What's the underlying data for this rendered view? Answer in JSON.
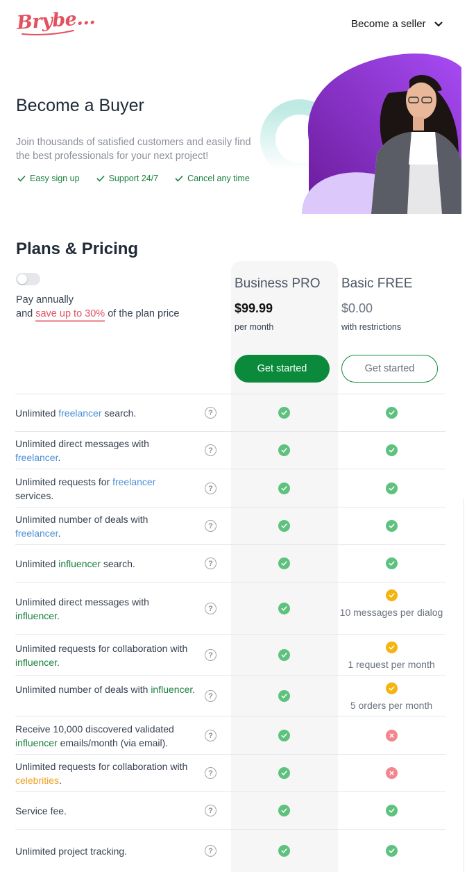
{
  "brand": {
    "logo_text": "Brybe...",
    "accent": "#e2515f"
  },
  "header": {
    "seller_label": "Become a seller",
    "seller_icon": "chevron-down-icon"
  },
  "hero": {
    "title": "Become a Buyer",
    "subtitle": "Join thousands of satisfied customers and easily find the best professionals for your next project!",
    "checks": [
      "Easy sign up",
      "Support 24/7",
      "Cancel any time"
    ]
  },
  "pricing": {
    "title": "Plans & Pricing",
    "toggle_on": false,
    "pay_annually": "Pay annually",
    "save_prefix": "and",
    "save_link": "save up to 30%",
    "save_suffix": "of the plan price",
    "plans": [
      {
        "name": "Business PRO",
        "price": "$99.99",
        "note": "per month",
        "button": "Get started"
      },
      {
        "name": "Basic FREE",
        "price": "$0.00",
        "note": "with restrictions",
        "button": "Get started"
      }
    ],
    "features": [
      {
        "pre": "Unlimited ",
        "hl": "freelancer",
        "hl_color": "blue",
        "post": " search.",
        "pro": "check",
        "free": "check",
        "free_note": ""
      },
      {
        "pre": "Unlimited direct messages with ",
        "hl": "freelancer",
        "hl_color": "blue",
        "post": ".",
        "pro": "check",
        "free": "check",
        "free_note": ""
      },
      {
        "pre": "Unlimited requests for ",
        "hl": "freelancer",
        "hl_color": "blue",
        "post": " services.",
        "pro": "check",
        "free": "check",
        "free_note": ""
      },
      {
        "pre": "Unlimited number of deals with ",
        "hl": "freelancer",
        "hl_color": "blue",
        "post": ".",
        "pro": "check",
        "free": "check",
        "free_note": ""
      },
      {
        "pre": "Unlimited ",
        "hl": "influencer",
        "hl_color": "green",
        "post": " search.",
        "pro": "check",
        "free": "check",
        "free_note": ""
      },
      {
        "pre": "Unlimited direct messages with ",
        "hl": "influencer",
        "hl_color": "green",
        "post": ".",
        "pro": "check",
        "free": "limited",
        "free_note": "10 messages per dialog"
      },
      {
        "pre": "Unlimited requests for collaboration with ",
        "hl": "influencer",
        "hl_color": "green",
        "post": ".",
        "pro": "check",
        "free": "limited",
        "free_note": "1 request per month"
      },
      {
        "pre": "Unlimited number of deals with ",
        "hl": "influencer",
        "hl_color": "green",
        "post": ".",
        "pro": "check",
        "free": "limited",
        "free_note": "5 orders per month"
      },
      {
        "pre": "Receive 10,000 discovered validated ",
        "hl": "influencer",
        "hl_color": "green",
        "post": " emails/month (via email).",
        "pro": "check",
        "free": "cross",
        "free_note": ""
      },
      {
        "pre": "Unlimited requests for collaboration with ",
        "hl": "celebrities",
        "hl_color": "orange",
        "post": ".",
        "pro": "check",
        "free": "cross",
        "free_note": ""
      },
      {
        "pre": "Service fee.",
        "hl": "",
        "hl_color": "",
        "post": "",
        "pro": "check",
        "free": "check",
        "free_note": ""
      },
      {
        "pre": "Unlimited project tracking.",
        "hl": "",
        "hl_color": "",
        "post": "",
        "pro": "check",
        "free": "check",
        "free_note": ""
      }
    ]
  },
  "colors": {
    "check": "#5ec27e",
    "limited": "#f5b40f",
    "cross": "#f2868d",
    "primary_button": "#0a8a3a"
  },
  "icons": {
    "check": "check-circle-icon",
    "limited": "check-circle-warning-icon",
    "cross": "cross-circle-icon",
    "help": "question-mark-icon"
  }
}
